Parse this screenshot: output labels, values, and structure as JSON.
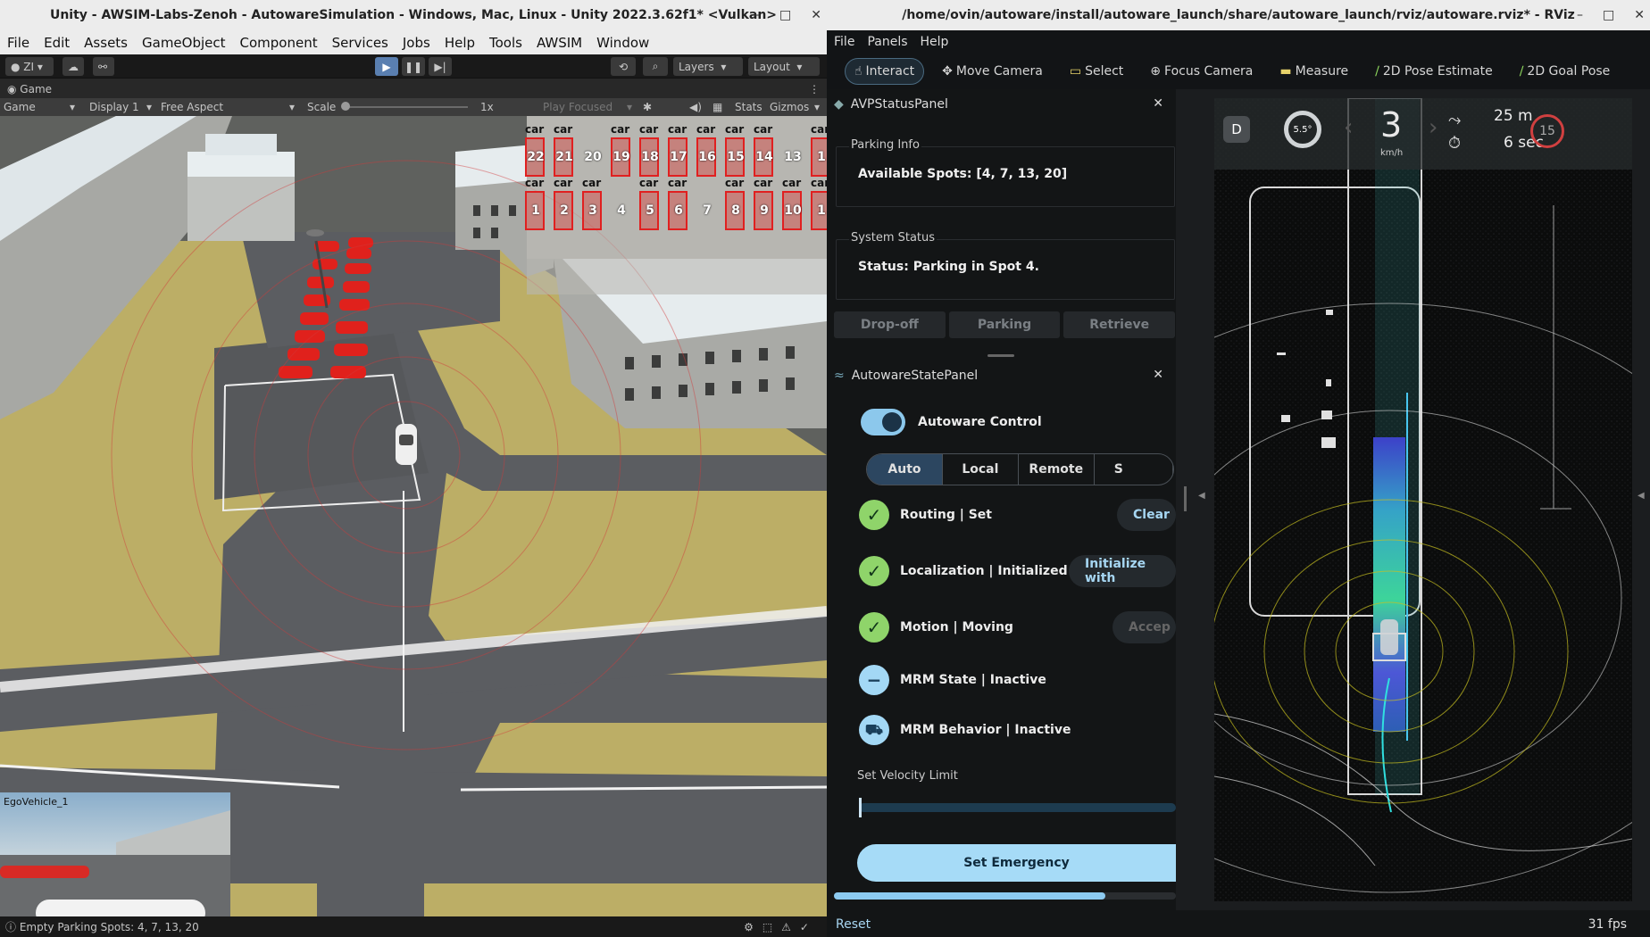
{
  "unity": {
    "title": "Unity - AWSIM-Labs-Zenoh - AutowareSimulation - Windows, Mac, Linux - Unity 2022.3.62f1* <Vulkan>",
    "menu": [
      "File",
      "Edit",
      "Assets",
      "GameObject",
      "Component",
      "Services",
      "Jobs",
      "Help",
      "Tools",
      "AWSIM",
      "Window"
    ],
    "account": "ZI",
    "layers": "Layers",
    "layout": "Layout",
    "tab_game": "Game",
    "gamebar": {
      "mode": "Game",
      "display": "Display 1",
      "aspect": "Free Aspect",
      "scale_label": "Scale",
      "scale_value": "1x",
      "play_focused": "Play Focused",
      "stats": "Stats",
      "gizmos": "Gizmos"
    },
    "status": "Empty Parking Spots: 4, 7, 13, 20",
    "minimap_label": "EgoVehicle_1",
    "spot_label": "car",
    "spots_top": [
      "22",
      "21",
      "20",
      "19",
      "18",
      "17",
      "16",
      "15",
      "14",
      "13",
      "1"
    ],
    "spots_top_empty": [
      "20",
      "13"
    ],
    "spots_bottom": [
      "1",
      "2",
      "3",
      "4",
      "5",
      "6",
      "7",
      "8",
      "9",
      "10",
      "1"
    ],
    "spots_bottom_empty": [
      "4",
      "7"
    ]
  },
  "rviz": {
    "title": "/home/ovin/autoware/install/autoware_launch/share/autoware_launch/rviz/autoware.rviz* - RViz",
    "menu": [
      "File",
      "Panels",
      "Help"
    ],
    "tools": [
      "Interact",
      "Move Camera",
      "Select",
      "Focus Camera",
      "Measure",
      "2D Pose Estimate",
      "2D Goal Pose"
    ],
    "avp_panel": {
      "title": "AVPStatusPanel",
      "parking_info_label": "Parking Info",
      "available_spots": "Available Spots: [4, 7, 13, 20]",
      "system_status_label": "System Status",
      "status_text": "Status:  Parking in Spot 4.",
      "buttons": [
        "Drop-off",
        "Parking",
        "Retrieve"
      ]
    },
    "state_panel": {
      "title": "AutowareStatePanel",
      "control_label": "Autoware Control",
      "modes": [
        "Auto",
        "Local",
        "Remote",
        "S"
      ],
      "routing": "Routing | Set",
      "routing_btn": "Clear",
      "localization": "Localization | Initialized",
      "localization_btn": "Initialize with",
      "motion": "Motion | Moving",
      "motion_btn": "Accep",
      "mrm_state": "MRM State | Inactive",
      "mrm_behavior": "MRM Behavior | Inactive",
      "velocity_label": "Set Velocity Limit",
      "emergency_btn": "Set Emergency"
    },
    "hud": {
      "gear": "D",
      "steering": "5.5°",
      "speed": "3",
      "speed_unit": "km/h",
      "distance": "25 m",
      "time": "6 sec",
      "limit": "15"
    },
    "reset": "Reset",
    "fps": "31 fps"
  }
}
